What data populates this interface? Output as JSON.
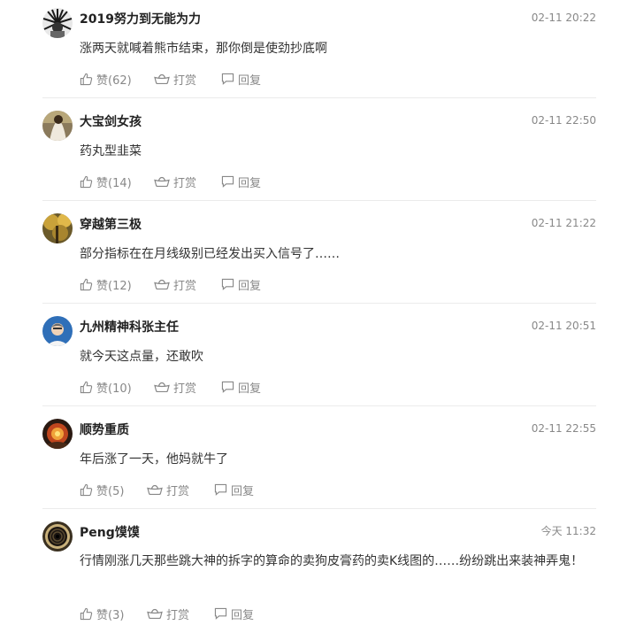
{
  "comments": [
    {
      "user": "2019努力到无能为力",
      "time": "02-11 20:22",
      "text": "涨两天就喊着熊市结束，那你倒是使劲抄底啊",
      "like_label": "赞(62)",
      "reward_label": "打赏",
      "reply_label": "回复"
    },
    {
      "user": "大宝剑女孩",
      "time": "02-11 22:50",
      "text": "药丸型韭菜",
      "like_label": "赞(14)",
      "reward_label": "打赏",
      "reply_label": "回复"
    },
    {
      "user": "穿越第三极",
      "time": "02-11 21:22",
      "text": "部分指标在在月线级别已经发出买入信号了……",
      "like_label": "赞(12)",
      "reward_label": "打赏",
      "reply_label": "回复"
    },
    {
      "user": "九州精神科张主任",
      "time": "02-11 20:51",
      "text": "就今天这点量，还敢吹",
      "like_label": "赞(10)",
      "reward_label": "打赏",
      "reply_label": "回复"
    },
    {
      "user": "顺势重质",
      "time": "02-11 22:55",
      "text": "年后涨了一天，他妈就牛了",
      "like_label": "赞(5)",
      "reward_label": "打赏",
      "reply_label": "回复"
    },
    {
      "user": "Peng馍馍",
      "time": "今天 11:32",
      "text": "行情刚涨几天那些跳大神的拆字的算命的卖狗皮膏药的卖K线图的……纷纷跳出来装神弄鬼！",
      "like_label": "赞(3)",
      "reward_label": "打赏",
      "reply_label": "回复"
    }
  ]
}
